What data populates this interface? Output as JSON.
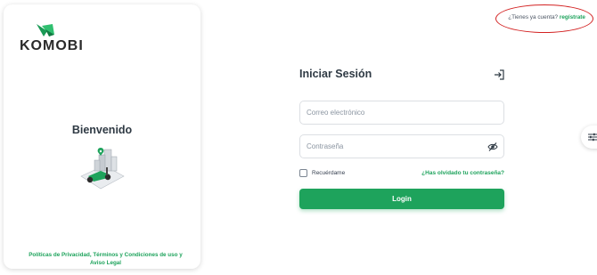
{
  "brand": {
    "name": "KOMOBI",
    "color": "#1ea35c"
  },
  "left_panel": {
    "welcome": "Bienvenido",
    "policy_link": "Políticas de Privacidad, Términos y Condiciones de uso y Aviso Legal"
  },
  "header": {
    "have_account": "¿Tienes ya cuenta?",
    "register_link": "regístrate"
  },
  "form": {
    "title": "Iniciar Sesión",
    "email_placeholder": "Correo electrónico",
    "email_value": "",
    "password_placeholder": "Contraseña",
    "password_value": "",
    "remember_label": "Recuérdame",
    "remember_checked": false,
    "forgot_link": "¿Has olvidado tu contraseña?",
    "login_button": "Login"
  },
  "icons": {
    "logo": "leaf-logo-icon",
    "login": "login-arrow-icon",
    "password_toggle": "eye-slash-icon",
    "side_panel": "sliders-icon",
    "illustration": "scooter-city-illustration"
  },
  "annotation": {
    "color": "#d32222"
  }
}
